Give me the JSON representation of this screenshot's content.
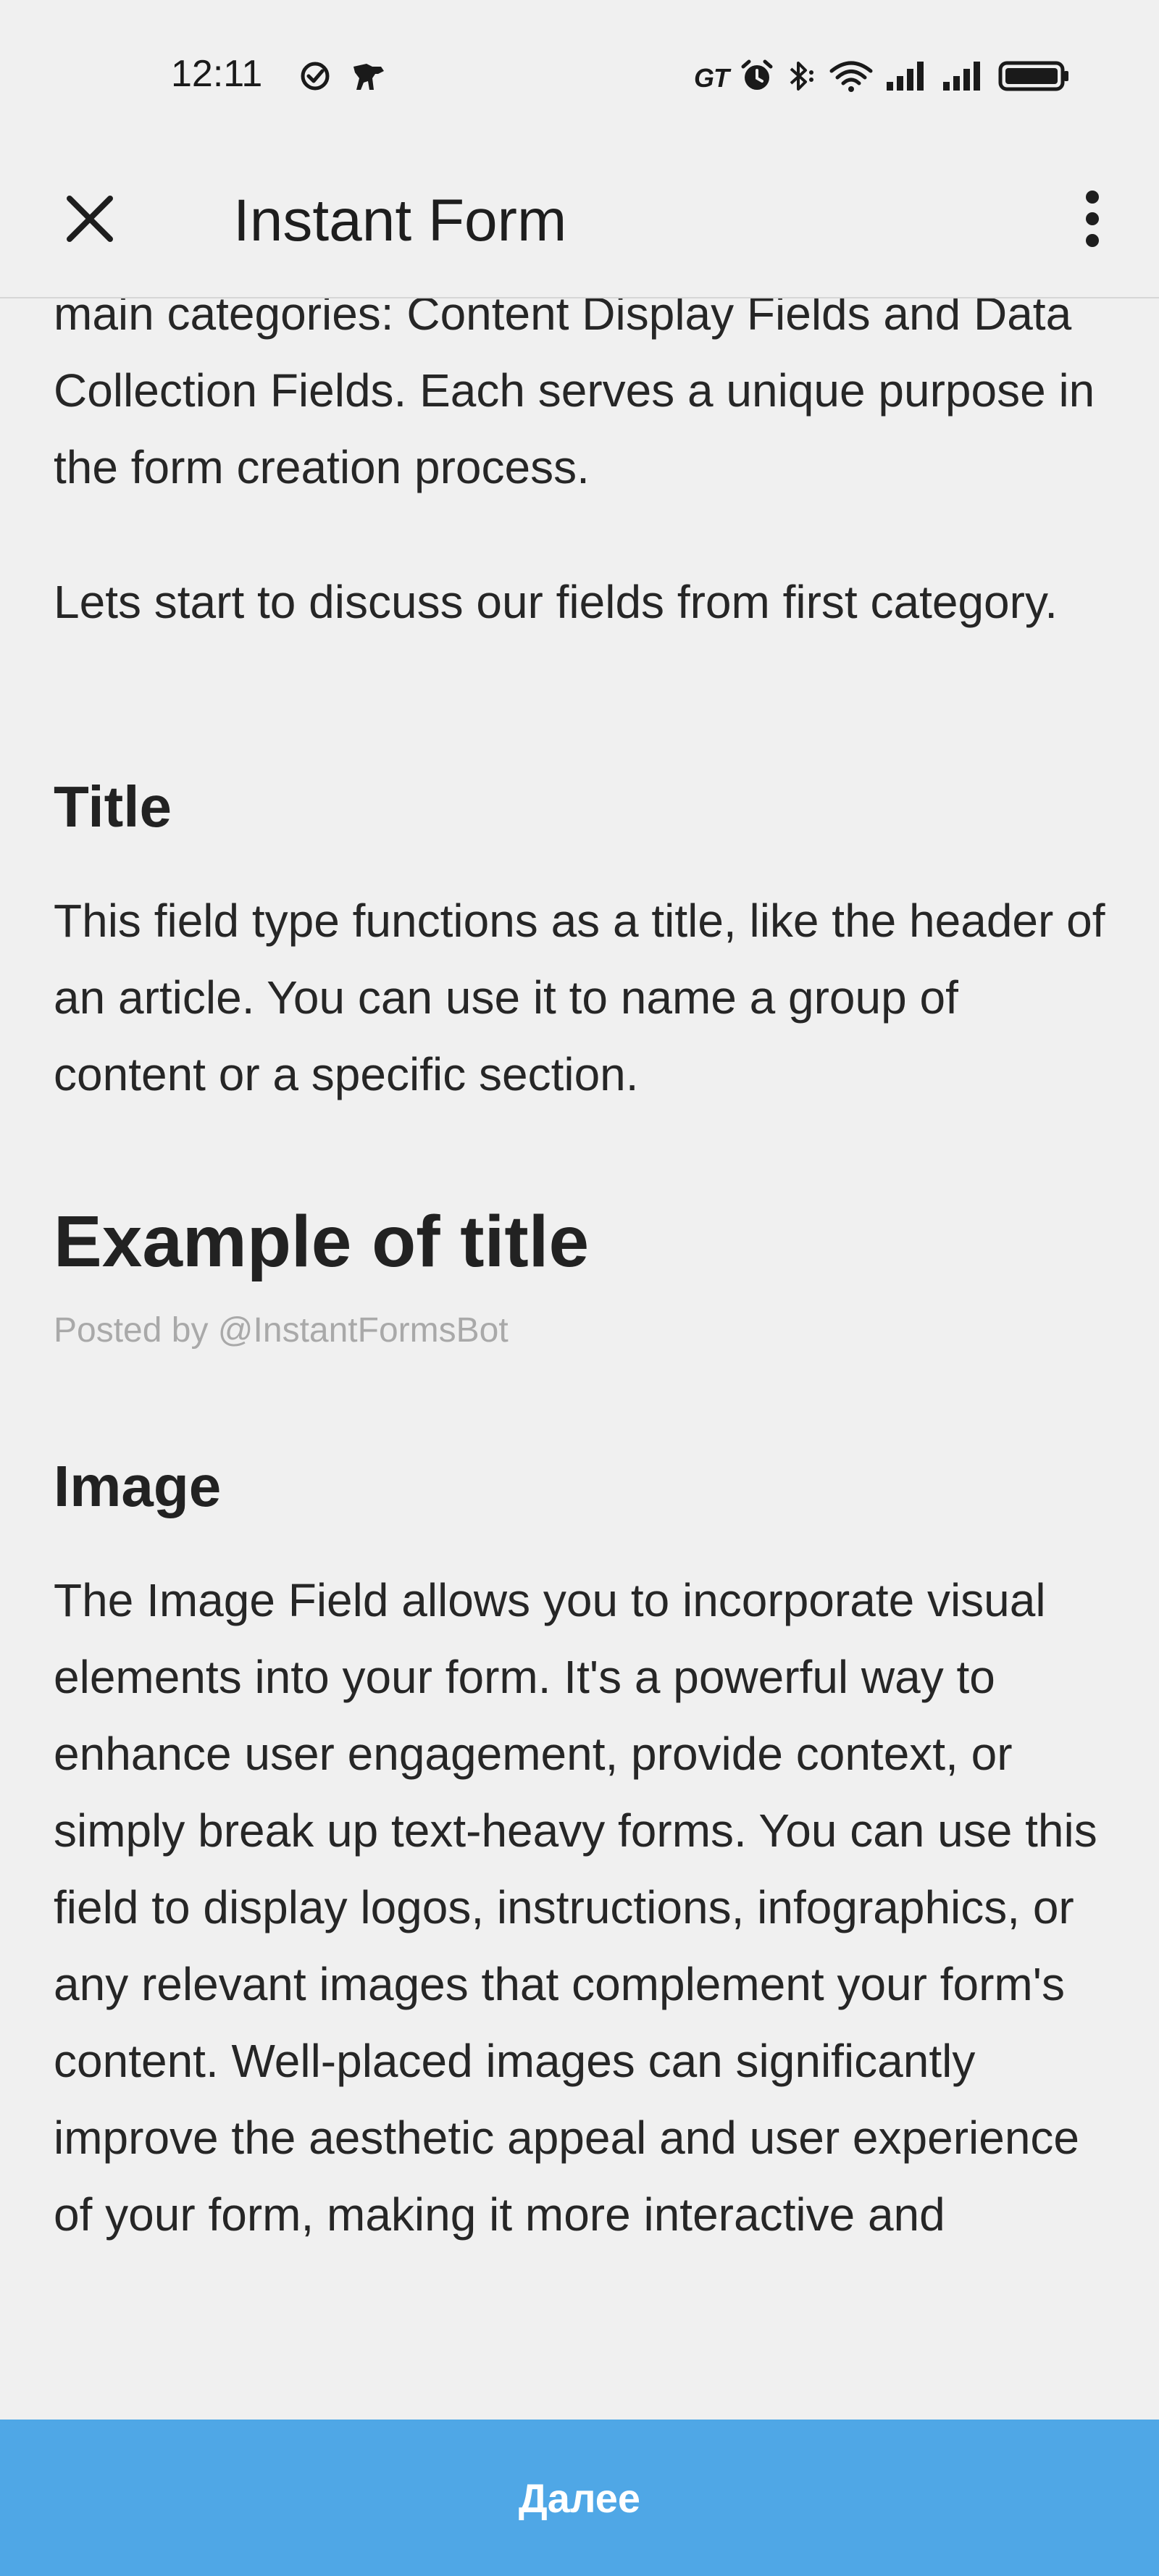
{
  "status_bar": {
    "time": "12:11",
    "gt_label": "GT",
    "icons": [
      "check-circle-icon",
      "dog-icon",
      "alarm-icon",
      "bluetooth-icon",
      "wifi-icon",
      "signal-icon",
      "signal-icon",
      "battery-icon"
    ]
  },
  "app_bar": {
    "title": "Instant Form",
    "close_icon": "close-icon",
    "menu_icon": "more-vertical-icon"
  },
  "content": {
    "intro_paragraph": "main categories: Content Display Fields and Data Collection Fields. Each serves a unique purpose in the form creation process.",
    "lets_start_paragraph": "Lets start to discuss our fields from first category.",
    "title_section": {
      "heading": "Title",
      "description": "This field type functions as a title, like the header of an article. You can use it to name a group of content or a specific section."
    },
    "example": {
      "title": "Example of title",
      "posted_by": "Posted by @InstantFormsBot"
    },
    "image_section": {
      "heading": "Image",
      "description": "The Image Field allows you to incorporate visual elements into your form. It's a powerful way to enhance user engagement, provide context, or simply break up text-heavy forms. You can use this field to display logos, instructions, infographics, or any relevant images that complement your form's content. Well-placed images can significantly improve the aesthetic appeal and user experience of your form, making it more interactive and"
    }
  },
  "footer": {
    "next_button_label": "Далее"
  },
  "colors": {
    "background": "#f0f0f0",
    "accent_button": "#4fa7e6",
    "text": "#222222",
    "muted_text": "#a9a9a9"
  }
}
